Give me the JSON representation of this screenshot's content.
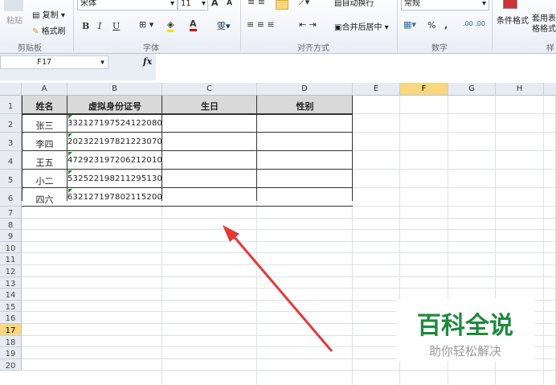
{
  "ribbon": {
    "clipboard": {
      "paste": "粘贴",
      "copy": "复制",
      "format_painter": "格式刷",
      "label": "剪贴板"
    },
    "font": {
      "name": "宋体",
      "size": "11",
      "bold": "B",
      "italic": "I",
      "underline": "U",
      "label": "字体"
    },
    "alignment": {
      "wrap": "自动换行",
      "merge": "合并后居中",
      "label": "对齐方式"
    },
    "number": {
      "format": "常规",
      "percent": "%",
      "comma": ",",
      "label": "数字"
    },
    "styles": {
      "conditional": "条件格式",
      "table": "套用表格格式",
      "label": "样式"
    }
  },
  "formula_bar": {
    "name_box": "F17",
    "fx": "fx",
    "value": ""
  },
  "columns": [
    "A",
    "B",
    "C",
    "D",
    "E",
    "F",
    "G",
    "H"
  ],
  "selected_column": "F",
  "selected_row": "17",
  "rows": [
    "1",
    "2",
    "3",
    "4",
    "5",
    "6",
    "7",
    "8",
    "9",
    "10",
    "11",
    "12",
    "13",
    "14",
    "15",
    "16",
    "17",
    "18",
    "19",
    "20"
  ],
  "table": {
    "headers": [
      "姓名",
      "虚拟身份证号",
      "生日",
      "性别"
    ],
    "data": [
      [
        "张三",
        "332127197524122080",
        "",
        ""
      ],
      [
        "李四",
        "202322197821223070",
        "",
        ""
      ],
      [
        "王五",
        "472923197206212010",
        "",
        ""
      ],
      [
        "小二",
        "532522198211295130",
        "",
        ""
      ],
      [
        "四六",
        "632127197802115200",
        "",
        ""
      ]
    ]
  },
  "watermark": {
    "title": "百科全说",
    "subtitle": "助你轻松解决"
  },
  "colors": {
    "header_fill": "#d9d9d9",
    "arrow": "#e53935",
    "watermark_green": "#1e8a3c",
    "selection": "#f8d77e"
  }
}
